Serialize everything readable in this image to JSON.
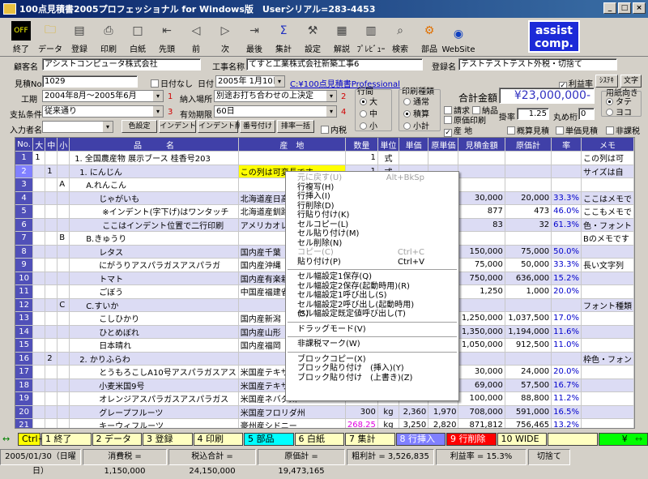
{
  "window": {
    "title": "100点見積書2005プロフェッショナル for Windows版　Userシリアル=283-4453"
  },
  "toolbar": [
    {
      "label": "終了",
      "icon": "off-icon"
    },
    {
      "label": "データ",
      "icon": "folder-icon"
    },
    {
      "label": "登録",
      "icon": "save-icon"
    },
    {
      "label": "印刷",
      "icon": "printer-icon"
    },
    {
      "label": "白紙",
      "icon": "blank-page-icon"
    },
    {
      "label": "先頭",
      "icon": "first-icon"
    },
    {
      "label": "前",
      "icon": "prev-icon"
    },
    {
      "label": "次",
      "icon": "next-icon"
    },
    {
      "label": "最後",
      "icon": "last-icon"
    },
    {
      "label": "集計",
      "icon": "sigma-icon"
    },
    {
      "label": "設定",
      "icon": "wrench-icon"
    },
    {
      "label": "解説",
      "icon": "help-icon"
    },
    {
      "label": "ﾌﾟﾚﾋﾞｭｰ",
      "icon": "preview-icon"
    },
    {
      "label": "検索",
      "icon": "search-icon"
    },
    {
      "label": "部品",
      "icon": "gear-icon"
    },
    {
      "label": "WebSite",
      "icon": "globe-icon"
    }
  ],
  "assist": {
    "line1": "assist",
    "line2": "comp."
  },
  "form": {
    "customer_label": "顧客名",
    "customer": "アシストコンピュータ株式会社",
    "project_label": "工事名称",
    "project": "てすと工業株式会社新築工事6",
    "reg_label": "登録名",
    "reg": "テストテストテスト外税・切捨て",
    "estno_label": "見積No.",
    "estno": "1029",
    "nodate_label": "日付なし",
    "date_label": "日付",
    "date": "2005年 1月10日",
    "path": "C:¥100点見積書Professional",
    "tax_label": "利益率",
    "btn_a": "ｼｽﾃｷ",
    "btn_b": "文字",
    "period_label": "工期",
    "period": "2004年8月～2005年6月",
    "n1": "1",
    "place_label": "納入場所",
    "place": "別途お打ち合わせの上決定",
    "n2": "2",
    "pay_label": "支払条件",
    "pay": "従来通り",
    "n3": "3",
    "valid_label": "有効期限",
    "valid": "60日",
    "n4": "4",
    "inputter_label": "入力者名",
    "inputter": "",
    "row_label": "行間",
    "row_opts": [
      "大",
      "中",
      "小"
    ],
    "print_label": "印刷種類",
    "print_opts": [
      "通常",
      "積算",
      "小計"
    ],
    "total_label": "合計金額",
    "total": "¥23,000,000-",
    "orient_label": "用紙向き",
    "orient_opts": [
      "タテ",
      "ヨコ"
    ],
    "cb_bill": "請求",
    "cb_deliv": "納品",
    "cb_cost": "原価印刷",
    "cb_origin": "産 地",
    "rate_label": "掛率",
    "rate": "1.25",
    "round_label": "丸め桁",
    "round": "0",
    "cb_summary": "概算見積",
    "cb_unit": "単価見積",
    "cb_nontax": "非課税",
    "btn_color": "色設定",
    "btn_indent": "インデント",
    "btn_indent_del": "インデント削除",
    "btn_renum": "番号付け",
    "btn_order": "排率一括",
    "cb_tax": "内税"
  },
  "grid": {
    "headers": [
      "No.",
      "大",
      "中",
      "小",
      "品　　　名",
      "産　地",
      "数量",
      "単位",
      "単価",
      "原単価",
      "見積金額",
      "原価計",
      "率",
      "メモ"
    ],
    "rows": [
      [
        "1",
        "1",
        "",
        "",
        "1. 全国農産物 展示ブース 桂香号203",
        "",
        "1",
        "式",
        "",
        "",
        "",
        "",
        "",
        "この列は可"
      ],
      [
        "2",
        "",
        "1",
        "",
        "1. にんじん",
        "この列は可変長です",
        "1",
        "式",
        "",
        "",
        "",
        "",
        "",
        "サイズは自"
      ],
      [
        "3",
        "",
        "",
        "A",
        "A.れんこん",
        "",
        "",
        "",
        "",
        "",
        "",
        "",
        "",
        ""
      ],
      [
        "4",
        "",
        "",
        "",
        "じゃがいも",
        "北海道産日高",
        "",
        "",
        "",
        "",
        "30,000",
        "20,000",
        "33.3%",
        "ここはメモで"
      ],
      [
        "5",
        "",
        "",
        "",
        "※インデント(字下げ)はワンタッチ",
        "北海道産釧路",
        "",
        "",
        "",
        "33",
        "877",
        "473",
        "46.0%",
        "ここもメモで"
      ],
      [
        "6",
        "",
        "",
        "",
        "ここはインデント位置で二行印刷",
        "アメリカオレゴン州モンタ",
        "",
        "",
        "",
        "29",
        "83",
        "32",
        "61.3%",
        "色・フォント"
      ],
      [
        "7",
        "",
        "",
        "B",
        "B.きゅうり",
        "",
        "",
        "",
        "",
        "",
        "",
        "",
        "",
        "Bのメモです"
      ],
      [
        "8",
        "",
        "",
        "",
        "レタス",
        "国内産千葉",
        "",
        "",
        "",
        "",
        "150,000",
        "75,000",
        "50.0%",
        ""
      ],
      [
        "9",
        "",
        "",
        "",
        "にがうりアスパラガスアスパラガ",
        "国内産沖縄",
        "",
        "",
        "",
        "",
        "75,000",
        "50,000",
        "33.3%",
        "長い文字列"
      ],
      [
        "10",
        "",
        "",
        "",
        "トマト",
        "国内産有楽栽培長野",
        "",
        "",
        "",
        "",
        "750,000",
        "636,000",
        "15.2%",
        ""
      ],
      [
        "11",
        "",
        "",
        "",
        "ごぼう",
        "中国産福建省",
        "",
        "",
        "",
        "",
        "1,250",
        "1,000",
        "20.0%",
        ""
      ],
      [
        "12",
        "",
        "",
        "C",
        "C.すいか",
        "",
        "",
        "",
        "",
        "",
        "",
        "",
        "",
        "フォント種類"
      ],
      [
        "13",
        "",
        "",
        "",
        "こしひかり",
        "国内産新潟",
        "",
        "",
        "",
        "",
        "1,250,000",
        "1,037,500",
        "17.0%",
        ""
      ],
      [
        "14",
        "",
        "",
        "",
        "ひとめぼれ",
        "国内産山形",
        "",
        "",
        "",
        "",
        "1,350,000",
        "1,194,000",
        "11.6%",
        ""
      ],
      [
        "15",
        "",
        "",
        "",
        "日本晴れ",
        "国内産福岡",
        "",
        "",
        "",
        "",
        "1,050,000",
        "912,500",
        "11.0%",
        ""
      ],
      [
        "16",
        "",
        "2",
        "",
        "2. かりふらわ",
        "",
        "",
        "",
        "",
        "",
        "",
        "",
        "",
        "枠色・フォン"
      ],
      [
        "17",
        "",
        "",
        "",
        "とうもろこしA10号アスパラガスアス",
        "米国産テキサス州邁伝子",
        "",
        "",
        "",
        "",
        "30,000",
        "24,000",
        "20.0%",
        ""
      ],
      [
        "18",
        "",
        "",
        "",
        "小麦米国9号",
        "米国産テキサス州邁伝子",
        "",
        "",
        "",
        "",
        "69,000",
        "57,500",
        "16.7%",
        ""
      ],
      [
        "19",
        "",
        "",
        "",
        "オレンジアスパラガスアスパラガス",
        "米国産ネバダ州",
        "",
        "",
        "",
        "",
        "100,000",
        "88,800",
        "11.2%",
        ""
      ],
      [
        "20",
        "",
        "",
        "",
        "グレープフルーツ",
        "米国産フロリダ州",
        "300",
        "kg",
        "2,360",
        "1,970",
        "708,000",
        "591,000",
        "16.5%",
        ""
      ],
      [
        "21",
        "",
        "",
        "",
        "キーウィフルーツ",
        "豪州産シドニー",
        "268.25",
        "kg",
        "3,250",
        "2,820",
        "871,812",
        "756,465",
        "13.2%",
        ""
      ]
    ]
  },
  "context_menu": [
    {
      "label": "元に戻す(U)",
      "key": "Alt+BkSp",
      "disabled": true
    },
    {
      "label": "行複写(H)",
      "key": ""
    },
    {
      "label": "行挿入(I)",
      "key": ""
    },
    {
      "label": "行削除(D)",
      "key": ""
    },
    {
      "label": "行貼り付け(K)",
      "key": ""
    },
    {
      "label": "セルコピー(L)",
      "key": ""
    },
    {
      "label": "セル貼り付け(M)",
      "key": ""
    },
    {
      "label": "セル削除(N)",
      "key": ""
    },
    {
      "label": "コピー(C)",
      "key": "Ctrl+C",
      "disabled": true
    },
    {
      "label": "貼り付け(P)",
      "key": "Ctrl+V"
    },
    {
      "sep": true
    },
    {
      "label": "セル幅設定1保存(Q)",
      "key": ""
    },
    {
      "label": "セル幅設定2保存(起動時用)(R)",
      "key": ""
    },
    {
      "label": "セル幅設定1呼び出し(S)",
      "key": ""
    },
    {
      "label": "セル幅設定2呼び出し(起動時用)(S)",
      "key": ""
    },
    {
      "label": "セル幅設定既定値呼び出し(T)",
      "key": ""
    },
    {
      "sep": true
    },
    {
      "label": "ドラッグモード(V)",
      "key": ""
    },
    {
      "sep": true
    },
    {
      "label": "非課税マーク(W)",
      "key": ""
    },
    {
      "sep": true
    },
    {
      "label": "ブロックコピー(X)",
      "key": ""
    },
    {
      "label": "ブロック貼り付け　(挿入)(Y)",
      "key": ""
    },
    {
      "label": "ブロック貼り付け　(上書き)(Z)",
      "key": ""
    }
  ],
  "fkeys": [
    "Ctrl+F",
    "1 終了",
    "2 データ",
    "3 登録",
    "4 印刷",
    "5 部品",
    "6 白紙",
    "7 集計",
    "8 行挿入",
    "9 行削除",
    "10 WIDE",
    "",
    ""
  ],
  "fkey_yen": "¥",
  "status": [
    "2005/01/30（日曜日）",
    "消費税 = 1,150,000",
    "税込合計 = 24,150,000",
    "原価計 = 19,473,165",
    "粗利計 = 3,526,835",
    "利益率 = 15.3%",
    "切捨て"
  ]
}
